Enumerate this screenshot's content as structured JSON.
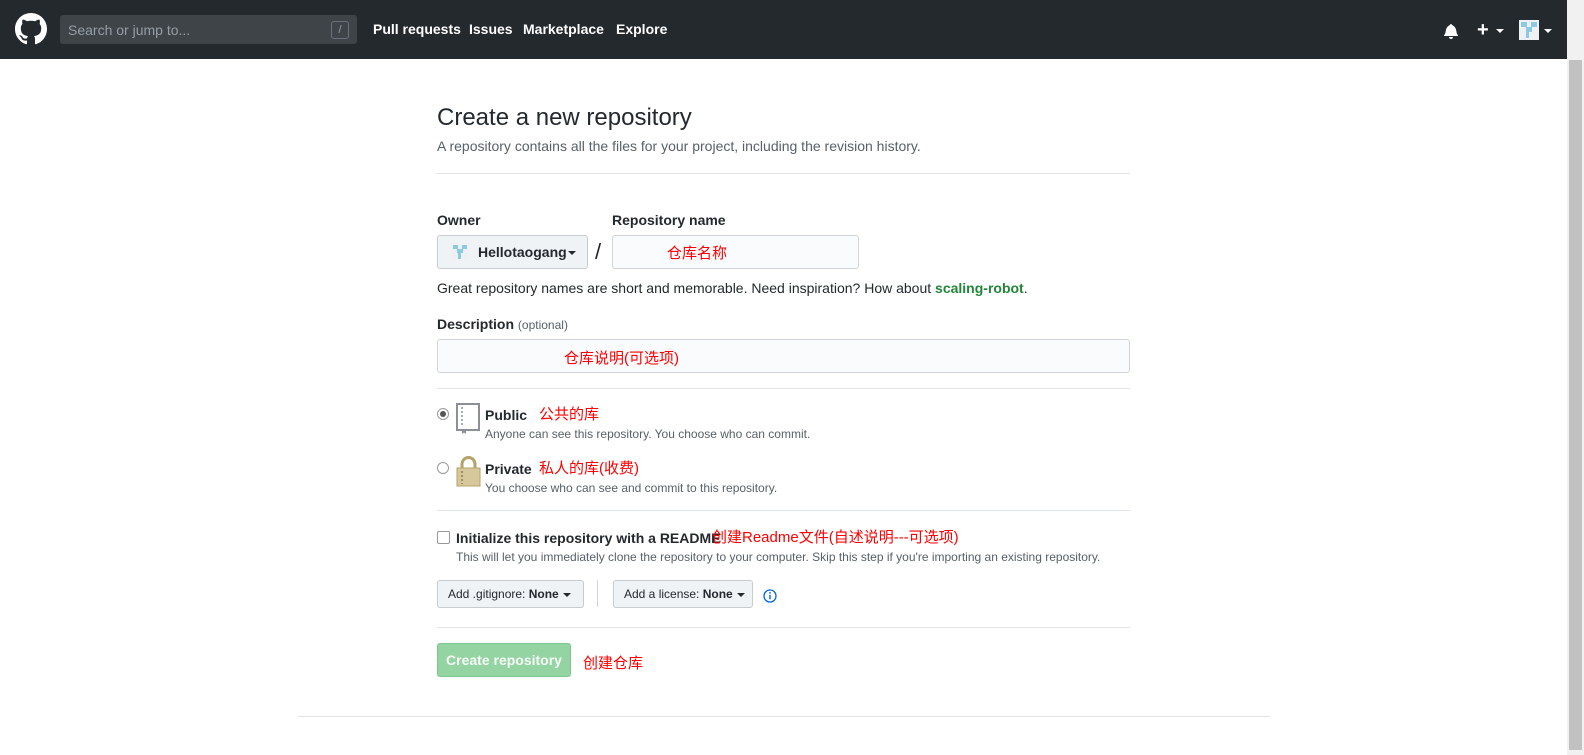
{
  "header": {
    "search_placeholder": "Search or jump to...",
    "search_shortcut": "/",
    "nav": [
      "Pull requests",
      "Issues",
      "Marketplace",
      "Explore"
    ],
    "plus_label": "+"
  },
  "page": {
    "title": "Create a new repository",
    "subtitle": "A repository contains all the files for your project, including the revision history."
  },
  "form": {
    "owner_label": "Owner",
    "owner_name": "Hellotaogang",
    "separator": "/",
    "repo_name_label": "Repository name",
    "repo_name_annotation": "仓库名称",
    "hint_prefix": "Great repository names are short and memorable. Need inspiration? How about ",
    "hint_suggestion": "scaling-robot",
    "hint_suffix": ".",
    "description_label": "Description",
    "description_optional": "(optional)",
    "description_annotation": "仓库说明(可选项)",
    "public_label": "Public",
    "public_annotation": "公共的库",
    "public_desc": "Anyone can see this repository. You choose who can commit.",
    "private_label": "Private",
    "private_annotation": "私人的库(收费)",
    "private_desc": "You choose who can see and commit to this repository.",
    "readme_label": "Initialize this repository with a README",
    "readme_annotation": "创建Readme文件(自述说明---可选项)",
    "readme_desc": "This will let you immediately clone the repository to your computer. Skip this step if you're importing an existing repository.",
    "gitignore_label": "Add .gitignore:",
    "gitignore_value": "None",
    "license_label": "Add a license:",
    "license_value": "None",
    "create_button": "Create repository",
    "create_annotation": "创建仓库"
  },
  "colors": {
    "header_bg": "#24292e",
    "annotation": "#ff0000",
    "create_button_bg": "#94d3a2"
  }
}
